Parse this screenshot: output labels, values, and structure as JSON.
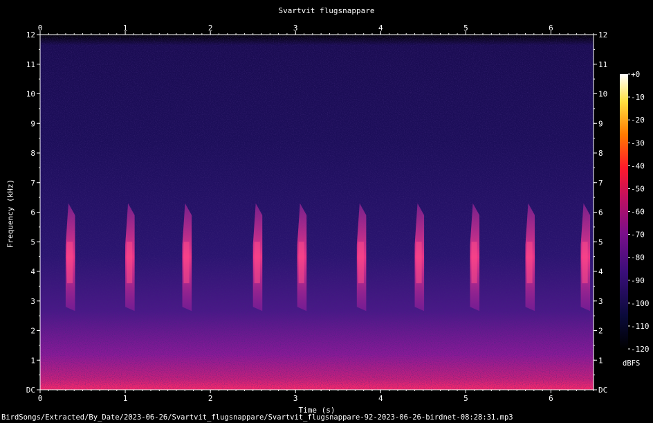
{
  "chart_data": {
    "type": "heatmap",
    "title": "Svartvit flugsnappare",
    "xlabel": "Time (s)",
    "ylabel": "Frequency (kHz)",
    "xlim": [
      0,
      6.5
    ],
    "ylim": [
      0,
      12
    ],
    "x_ticks": [
      "0",
      "1",
      "2",
      "3",
      "4",
      "5",
      "6"
    ],
    "y_ticks": [
      "DC",
      "1",
      "2",
      "3",
      "4",
      "5",
      "6",
      "7",
      "8",
      "9",
      "10",
      "11",
      "12"
    ],
    "colorbar": {
      "label": "dBFS",
      "ticks": [
        "+0",
        "-10",
        "-20",
        "-30",
        "-40",
        "-50",
        "-60",
        "-70",
        "-80",
        "-90",
        "-100",
        "-110",
        "-120"
      ],
      "range": [
        -120,
        0
      ]
    },
    "calls_time_s": [
      0.35,
      1.05,
      1.72,
      2.55,
      3.07,
      3.77,
      4.45,
      5.1,
      5.75,
      6.4
    ],
    "calls_freq_khz": [
      2.8,
      6.3
    ]
  },
  "colors": {
    "background": "#000000",
    "text": "#ffffff",
    "spectrogram_low": "#1a0a4a",
    "spectrogram_mid": "#7a1a9a",
    "spectrogram_high": "#ff3a7a"
  },
  "footer": "BirdSongs/Extracted/By_Date/2023-06-26/Svartvit_flugsnappare/Svartvit_flugsnappare-92-2023-06-26-birdnet-08:28:31.mp3"
}
